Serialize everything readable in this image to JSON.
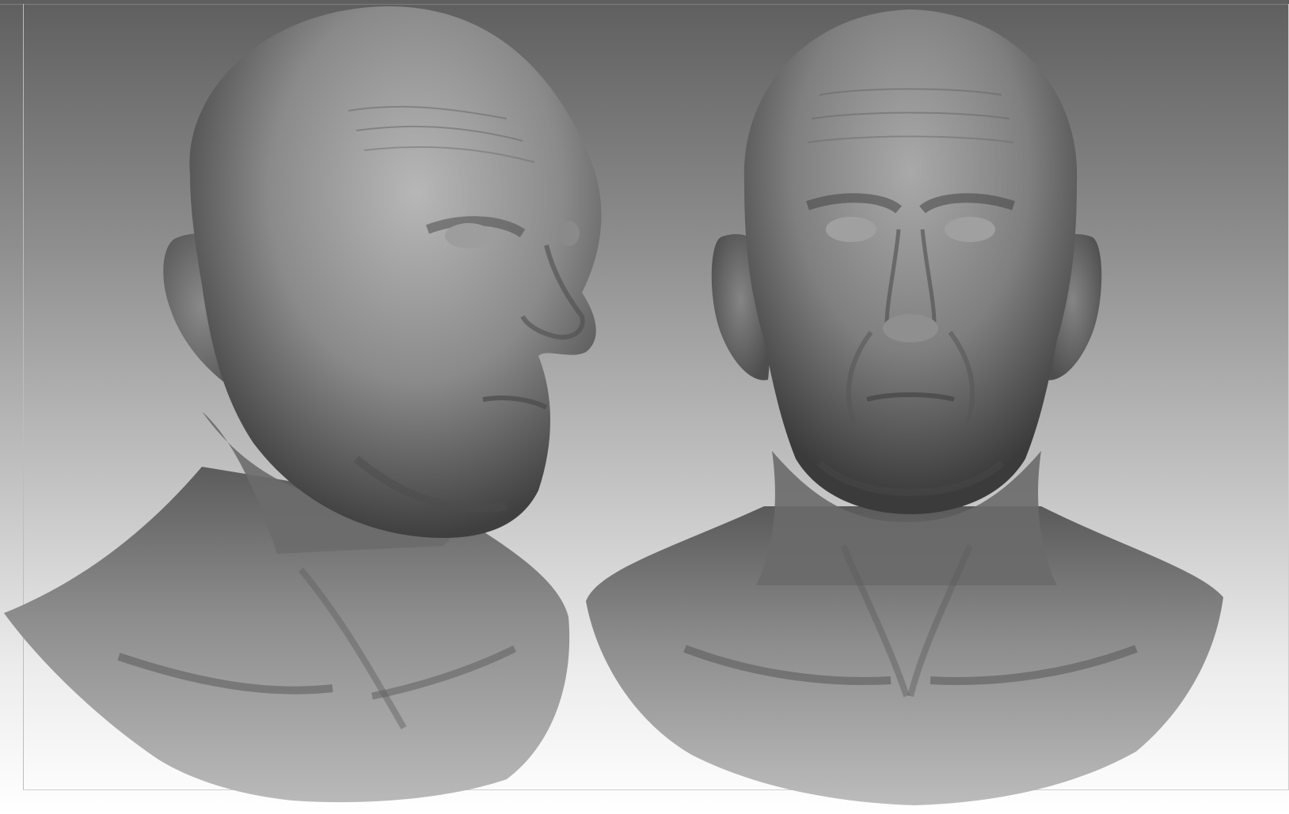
{
  "canvas": {
    "background_top": "#5f5f5f",
    "background_bottom": "#ffffff",
    "clay_color": "#8a8a8a"
  },
  "models": [
    {
      "name": "three-quarter-view-bust",
      "view": "three-quarter"
    },
    {
      "name": "front-view-bust",
      "view": "front"
    }
  ]
}
